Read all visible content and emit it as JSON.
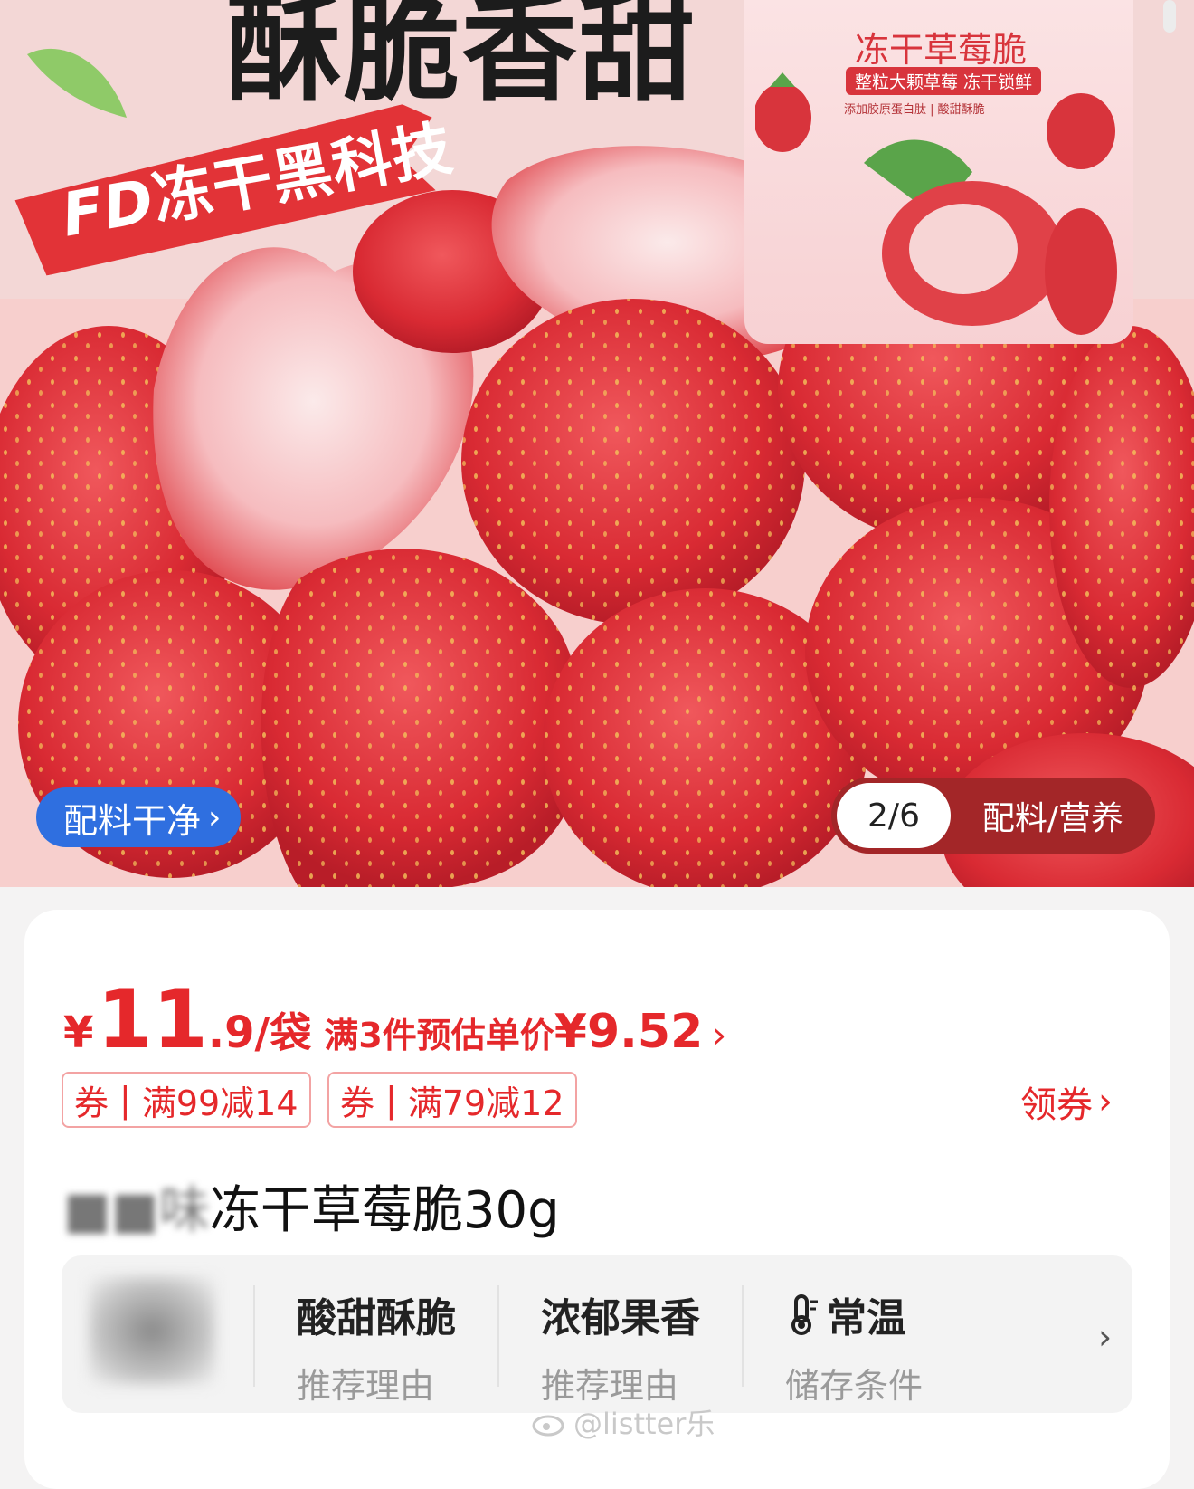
{
  "hero": {
    "headline": "酥脆香甜",
    "badge_fd": "FD",
    "badge_text": "冻干黑科技",
    "package_title": "冻干草莓脆",
    "package_subtitle": "整粒大颗草莓 冻干锁鲜",
    "package_features": "添加胶原蛋白肽 | 酸甜酥脆",
    "left_pill": "配料干净",
    "pager_count": "2/6",
    "pager_tab": "配料/营养"
  },
  "price": {
    "currency": "¥",
    "integer": "11",
    "decimal": ".9",
    "unit": "/袋",
    "promo_text": "满3件预估单价",
    "promo_price": "¥9.52"
  },
  "coupons": [
    {
      "tag": "券",
      "text": "满99减14"
    },
    {
      "tag": "券",
      "text": "满79减12"
    }
  ],
  "get_coupon": "领券",
  "product": {
    "title_blurred": "■■味",
    "title": "冻干草莓脆30g"
  },
  "attributes": [
    {
      "main": "酸甜酥脆",
      "sub": "推荐理由"
    },
    {
      "main": "浓郁果香",
      "sub": "推荐理由"
    },
    {
      "main": "常温",
      "sub": "储存条件",
      "icon": "thermometer-icon"
    }
  ],
  "watermark": "@listter乐",
  "colors": {
    "accent": "#e5282b",
    "pill_blue": "#2f6fe0",
    "pager_bg": "#a32628"
  }
}
